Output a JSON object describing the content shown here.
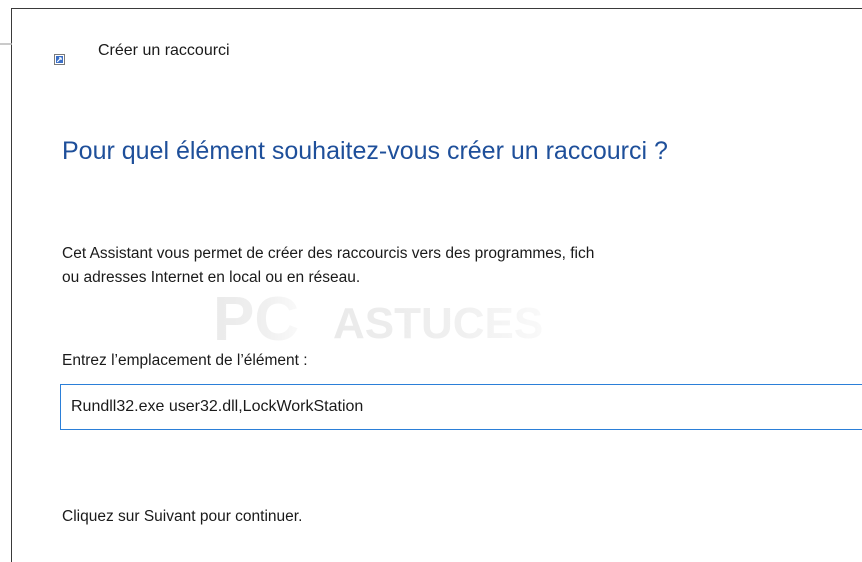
{
  "window": {
    "title": "Créer un raccourci",
    "back_icon": "back-arrow-icon",
    "title_icon": "shortcut-icon"
  },
  "page": {
    "heading": "Pour quel élément souhaitez-vous créer un raccourci ?",
    "description_line1": "Cet Assistant vous permet de créer des raccourcis vers des programmes, fich",
    "description_line2": "ou adresses Internet en local ou en réseau.",
    "location_label": "Entrez l’emplacement de l’élément :",
    "location_value": "Rundll32.exe user32.dll,LockWorkStation",
    "continue_note": "Cliquez sur Suivant pour continuer."
  },
  "watermark": {
    "text_pc": "PC",
    "text_astuces": "ASTUCES"
  },
  "colors": {
    "heading": "#1e4f9a",
    "input_border": "#2b7fd8",
    "text": "#1a1a1a"
  }
}
